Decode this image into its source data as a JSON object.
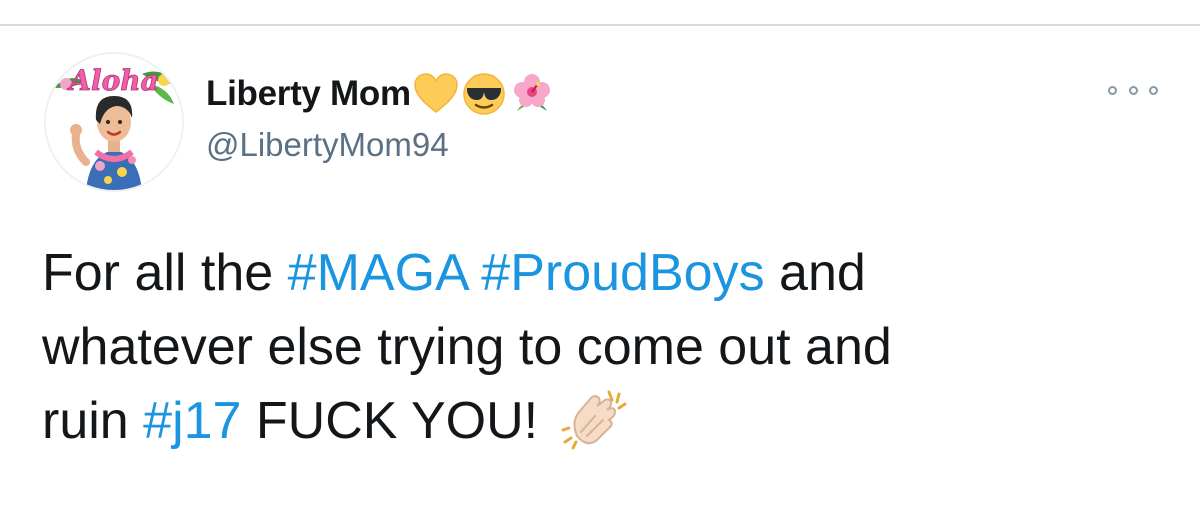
{
  "tweet": {
    "display_name": "Liberty Mom",
    "name_emojis": [
      "yellow-heart-icon",
      "sunglasses-face-icon",
      "hibiscus-icon"
    ],
    "handle": "@LibertyMom94",
    "avatar_text": "Aloha",
    "text": {
      "line1_prefix": "For all the ",
      "hashtag_maga": "#MAGA",
      "hashtag_proudboys": "#ProudBoys",
      "line1_suffix": " and",
      "line2": "whatever else trying to come out and",
      "line3_prefix": "ruin ",
      "hashtag_j17": "#j17",
      "line3_suffix": " FUCK YOU!",
      "trailing_emoji": "clapping-hands-icon"
    }
  },
  "colors": {
    "hashtag": "#1b95e0",
    "text": "#14171a",
    "handle": "#5b7083",
    "divider": "#d6dbdf"
  }
}
